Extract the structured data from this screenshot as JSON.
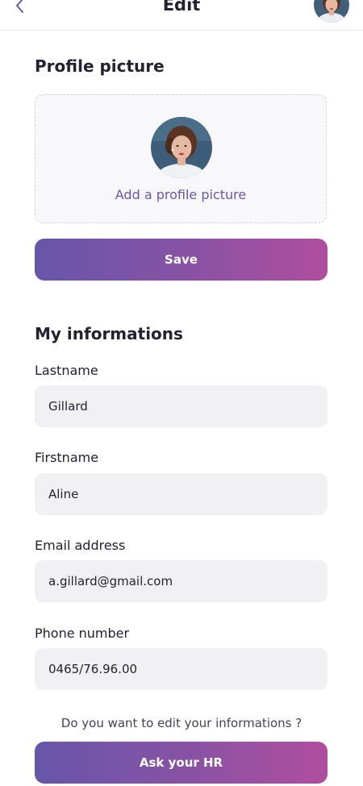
{
  "header": {
    "back_icon": "chevron-left-icon",
    "title": "Edit"
  },
  "profile_picture": {
    "section_title": "Profile picture",
    "upload_label": "Add a profile picture",
    "save_label": "Save"
  },
  "informations": {
    "section_title": "My informations",
    "fields": [
      {
        "label": "Lastname",
        "value": "Gillard"
      },
      {
        "label": "Firstname",
        "value": "Aline"
      },
      {
        "label": "Email address",
        "value": "a.gillard@gmail.com"
      },
      {
        "label": "Phone number",
        "value": "0465/76.96.00"
      }
    ]
  },
  "footer": {
    "question": "Do you want to edit your informations ?",
    "ask_hr_label": "Ask your HR"
  },
  "colors": {
    "accent": "#6a56a8",
    "gradient_start": "#6656a8",
    "gradient_end": "#b04e9e",
    "input_bg": "#f1f1f4"
  }
}
